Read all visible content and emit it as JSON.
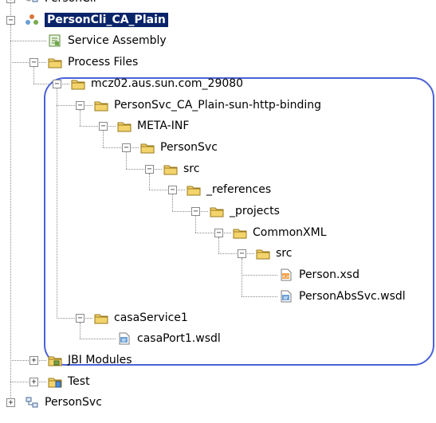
{
  "tree": {
    "nodes": [
      {
        "label": "PersonCli",
        "icon": "project-client-icon",
        "depth": 0,
        "expander": "+",
        "cut_top": true
      },
      {
        "label": "PersonCli_CA_Plain",
        "icon": "composite-app-icon",
        "depth": 0,
        "expander": "−",
        "selected": true
      },
      {
        "label": "Service Assembly",
        "icon": "service-assembly-icon",
        "depth": 1,
        "expander": null
      },
      {
        "label": "Process Files",
        "icon": "folder-icon",
        "depth": 1,
        "expander": "−"
      },
      {
        "label": "mcz02.aus.sun.com_29080",
        "icon": "folder-icon",
        "depth": 2,
        "expander": "−"
      },
      {
        "label": "PersonSvc_CA_Plain-sun-http-binding",
        "icon": "folder-icon",
        "depth": 3,
        "expander": "−"
      },
      {
        "label": "META-INF",
        "icon": "folder-icon",
        "depth": 4,
        "expander": "−"
      },
      {
        "label": "PersonSvc",
        "icon": "folder-icon",
        "depth": 5,
        "expander": "−"
      },
      {
        "label": "src",
        "icon": "folder-icon",
        "depth": 6,
        "expander": "−"
      },
      {
        "label": "_references",
        "icon": "folder-icon",
        "depth": 7,
        "expander": "−"
      },
      {
        "label": "_projects",
        "icon": "folder-icon",
        "depth": 8,
        "expander": "−"
      },
      {
        "label": "CommonXML",
        "icon": "folder-icon",
        "depth": 9,
        "expander": "−"
      },
      {
        "label": "src",
        "icon": "folder-icon",
        "depth": 10,
        "expander": "−"
      },
      {
        "label": "Person.xsd",
        "icon": "xsd-file-icon",
        "depth": 11,
        "expander": null
      },
      {
        "label": "PersonAbsSvc.wsdl",
        "icon": "wsdl-file-icon",
        "depth": 11,
        "expander": null
      },
      {
        "label": "casaService1",
        "icon": "folder-icon",
        "depth": 3,
        "expander": "−"
      },
      {
        "label": "casaPort1.wsdl",
        "icon": "wsdl-file-icon",
        "depth": 4,
        "expander": null
      },
      {
        "label": "JBI Modules",
        "icon": "jbi-modules-icon",
        "depth": 1,
        "expander": "+"
      },
      {
        "label": "Test",
        "icon": "test-folder-icon",
        "depth": 1,
        "expander": "+"
      },
      {
        "label": "PersonSvc",
        "icon": "project-service-icon",
        "depth": 0,
        "expander": "+"
      }
    ]
  },
  "colors": {
    "selection_bg": "#0a246a",
    "selection_fg": "#ffffff",
    "highlight_outline": "#4a62d8",
    "folder_fill": "#f3d36b",
    "folder_stroke": "#9a7a1c"
  }
}
